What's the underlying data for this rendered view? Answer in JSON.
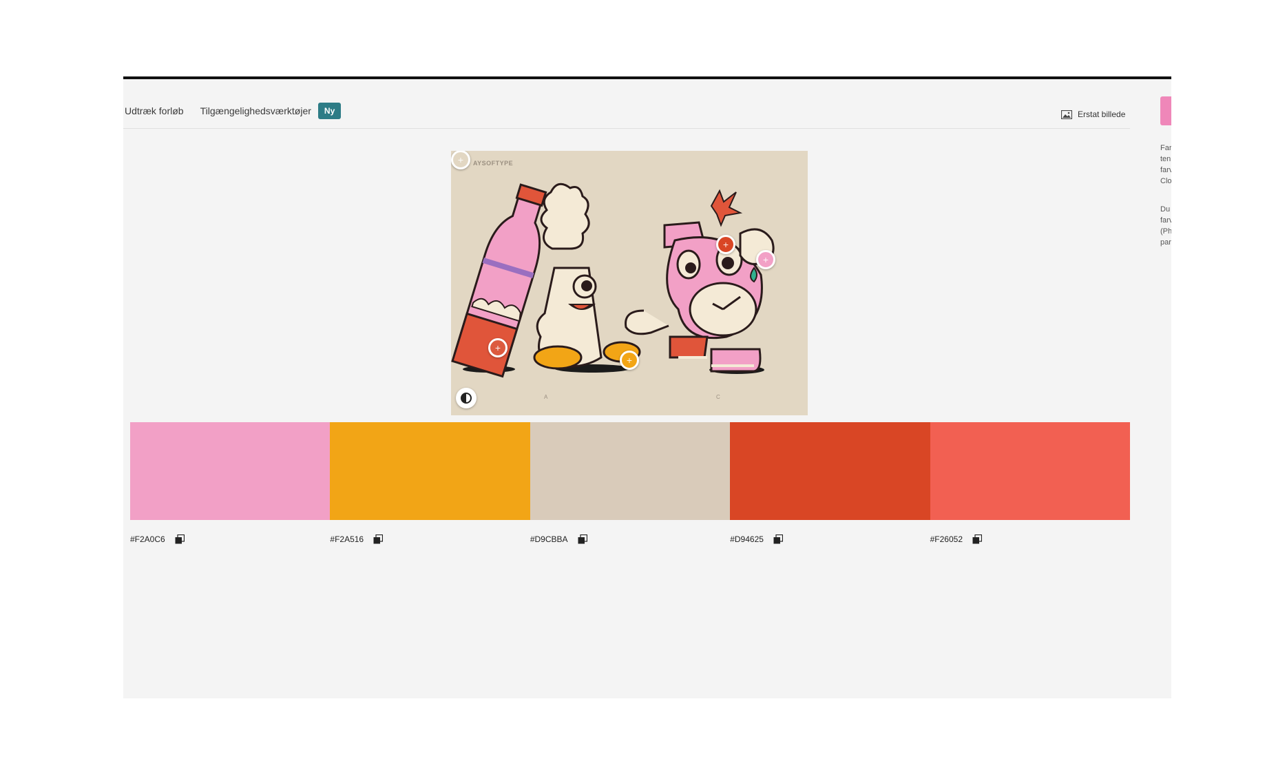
{
  "tabs": {
    "extract_gradient": "Udtræk forløb",
    "accessibility_tools": "Tilgængelighedsværktøjer",
    "new_badge": "Ny"
  },
  "replace_image_label": "Erstat billede",
  "side_panel": {
    "para1": "Far\nten\nfarv\nClo",
    "para2": "Du\nfarv\n(Ph\npar"
  },
  "image": {
    "brand": "AYSOFTYPE",
    "caption_left": "A",
    "caption_right": "C",
    "icons": {
      "contrast": "contrast-icon",
      "picker": "plus-icon",
      "replace": "image-icon",
      "copy": "copy-icon"
    }
  },
  "swatches": [
    {
      "hex": "#F2A0C6",
      "color": "#F2A0C6"
    },
    {
      "hex": "#F2A516",
      "color": "#F2A516"
    },
    {
      "hex": "#D9CBBA",
      "color": "#D9CBBA"
    },
    {
      "hex": "#D94625",
      "color": "#D94625"
    },
    {
      "hex": "#F26052",
      "color": "#F26052"
    }
  ],
  "pickers": [
    {
      "color": "#e2d7c3"
    },
    {
      "color": "#dc5a3e"
    },
    {
      "color": "#f2a516"
    },
    {
      "color": "#d94625"
    },
    {
      "color": "#f2a0c6"
    }
  ]
}
